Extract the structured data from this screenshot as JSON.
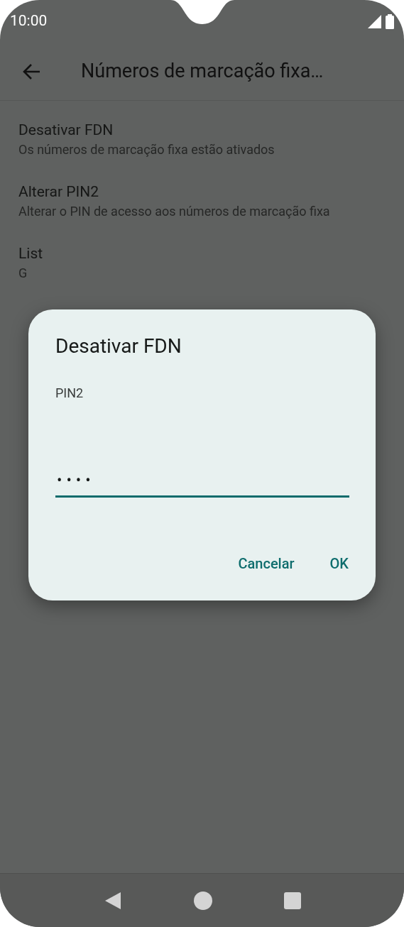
{
  "status_bar": {
    "time": "10:00"
  },
  "app_bar": {
    "title": "Números de marcação fixa…"
  },
  "items": [
    {
      "title": "Desativar FDN",
      "summary": "Os números de marcação fixa estão ativados"
    },
    {
      "title": "Alterar PIN2",
      "summary": "Alterar o PIN de acesso aos números de marcação fixa"
    },
    {
      "title": "List",
      "summary": "G"
    }
  ],
  "dialog": {
    "title": "Desativar FDN",
    "label": "PIN2",
    "value": "••••",
    "buttons": [
      "Cancelar",
      "OK"
    ]
  }
}
